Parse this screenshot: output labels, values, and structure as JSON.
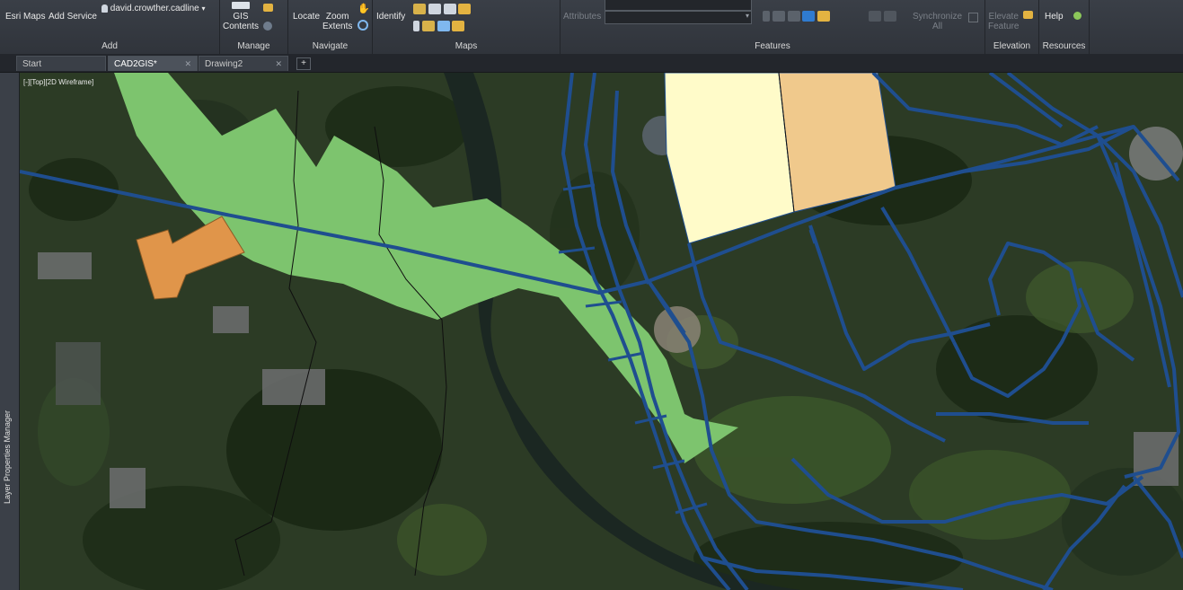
{
  "ribbon": {
    "add": {
      "title": "Add",
      "esri_maps": "Esri Maps",
      "add_service": "Add Service",
      "user": "david.crowther.cadline"
    },
    "manage": {
      "title": "Manage",
      "gis_contents": "GIS\nContents"
    },
    "navigate": {
      "title": "Navigate",
      "locate": "Locate",
      "zoom_extents": "Zoom\nExtents"
    },
    "maps": {
      "title": "Maps",
      "identify": "Identify"
    },
    "features": {
      "title": "Features",
      "attributes": "Attributes",
      "synchronize_all": "Synchronize\nAll"
    },
    "elevation": {
      "title": "Elevation",
      "elevate_feature": "Elevate\nFeature"
    },
    "resources": {
      "title": "Resources",
      "help": "Help"
    }
  },
  "tabs": [
    {
      "label": "Start",
      "active": false
    },
    {
      "label": "CAD2GIS*",
      "active": true
    },
    {
      "label": "Drawing2",
      "active": false
    }
  ],
  "sidebar": {
    "label": "Layer Properties Manager"
  },
  "viewport": {
    "label": "[-][Top][2D Wireframe]"
  },
  "colors": {
    "river_path": "#7dc46e",
    "pipes": "#1f4e8f",
    "parcel_light": "#fffbc9",
    "parcel_tan": "#f0c98c",
    "building": "#e0954a",
    "river": "#1b2722"
  }
}
